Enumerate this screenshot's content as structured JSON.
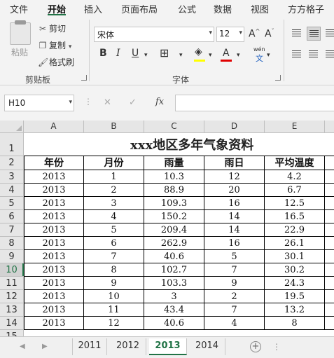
{
  "menu": {
    "items": [
      "文件",
      "开始",
      "插入",
      "页面布局",
      "公式",
      "数据",
      "视图",
      "方方格子"
    ],
    "active": "开始"
  },
  "ribbon": {
    "clipboard": {
      "paste_label": "粘贴",
      "cut_label": "剪切",
      "copy_label": "复制",
      "format_painter_label": "格式刷",
      "group_label": "剪贴板"
    },
    "font": {
      "font_name": "宋体",
      "font_size": "12",
      "grow_label": "A^",
      "shrink_label": "Aˇ",
      "bold": "B",
      "italic": "I",
      "underline": "U",
      "font_color_label": "A",
      "phonetic_label": "wén",
      "group_label": "字体"
    }
  },
  "formula_bar": {
    "name_box": "H10",
    "fx_label": "fx",
    "formula": ""
  },
  "columns": [
    "A",
    "B",
    "C",
    "D",
    "E"
  ],
  "row_numbers": [
    "1",
    "2",
    "3",
    "4",
    "5",
    "6",
    "7",
    "8",
    "9",
    "10",
    "11",
    "12",
    "13",
    "14",
    "15"
  ],
  "selected_row": "10",
  "sheet": {
    "title": "xxx地区多年气象资料",
    "headers": [
      "年份",
      "月份",
      "雨量",
      "雨日",
      "平均温度"
    ],
    "rows": [
      [
        "2013",
        "1",
        "10.3",
        "12",
        "4.2"
      ],
      [
        "2013",
        "2",
        "88.9",
        "20",
        "6.7"
      ],
      [
        "2013",
        "3",
        "109.3",
        "16",
        "12.5"
      ],
      [
        "2013",
        "4",
        "150.2",
        "14",
        "16.5"
      ],
      [
        "2013",
        "5",
        "209.4",
        "14",
        "22.9"
      ],
      [
        "2013",
        "6",
        "262.9",
        "16",
        "26.1"
      ],
      [
        "2013",
        "7",
        "40.6",
        "5",
        "30.1"
      ],
      [
        "2013",
        "8",
        "102.7",
        "7",
        "30.2"
      ],
      [
        "2013",
        "9",
        "103.3",
        "9",
        "24.3"
      ],
      [
        "2013",
        "10",
        "3",
        "2",
        "19.5"
      ],
      [
        "2013",
        "11",
        "43.4",
        "7",
        "13.2"
      ],
      [
        "2013",
        "12",
        "40.6",
        "4",
        "8"
      ]
    ]
  },
  "tabs": {
    "sheets": [
      "2011",
      "2012",
      "2013",
      "2014"
    ],
    "active": "2013",
    "add_label": "+",
    "more_label": "⋮"
  },
  "colors": {
    "accent": "#217346",
    "header_bg": "#e6e6e6",
    "ribbon_bg": "#f3f3f3"
  }
}
